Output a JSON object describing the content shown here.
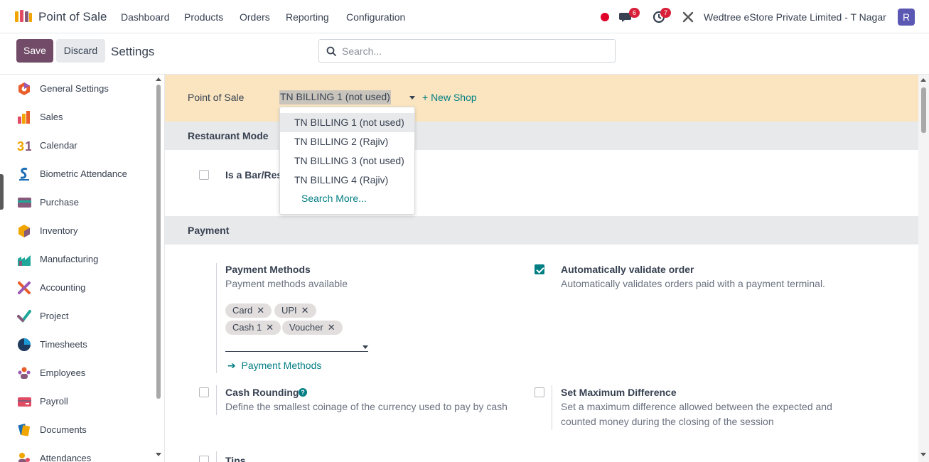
{
  "topnav": {
    "app_title": "Point of Sale",
    "menu": [
      "Dashboard",
      "Products",
      "Orders",
      "Reporting",
      "Configuration"
    ],
    "messages_badge": "6",
    "activities_badge": "7",
    "company": "Wedtree eStore Private Limited - T Nagar",
    "avatar_letter": "R"
  },
  "control": {
    "save_label": "Save",
    "discard_label": "Discard",
    "breadcrumb": "Settings",
    "search_placeholder": "Search..."
  },
  "sidebar": {
    "items": [
      {
        "label": "General Settings",
        "icon": "general-settings-icon"
      },
      {
        "label": "Sales",
        "icon": "sales-icon"
      },
      {
        "label": "Calendar",
        "icon": "calendar-icon"
      },
      {
        "label": "Biometric Attendance",
        "icon": "biometric-icon"
      },
      {
        "label": "Purchase",
        "icon": "purchase-icon"
      },
      {
        "label": "Inventory",
        "icon": "inventory-icon"
      },
      {
        "label": "Manufacturing",
        "icon": "manufacturing-icon"
      },
      {
        "label": "Accounting",
        "icon": "accounting-icon"
      },
      {
        "label": "Project",
        "icon": "project-icon"
      },
      {
        "label": "Timesheets",
        "icon": "timesheets-icon"
      },
      {
        "label": "Employees",
        "icon": "employees-icon"
      },
      {
        "label": "Payroll",
        "icon": "payroll-icon"
      },
      {
        "label": "Documents",
        "icon": "documents-icon"
      },
      {
        "label": "Attendances",
        "icon": "attendances-icon"
      }
    ]
  },
  "pos": {
    "label": "Point of Sale",
    "selected": "TN BILLING 1 (not used)",
    "new_shop": "+ New Shop",
    "dropdown": [
      "TN BILLING 1 (not used)",
      "TN BILLING 2 (Rajiv)",
      "TN BILLING 3 (not used)",
      "TN BILLING 4 (Rajiv)"
    ],
    "search_more": "Search More..."
  },
  "restaurant": {
    "heading": "Restaurant Mode",
    "bar_label": "Is a Bar/Restaurant"
  },
  "payment": {
    "heading": "Payment",
    "methods_title": "Payment Methods",
    "methods_desc": "Payment methods available",
    "tags": [
      "Card",
      "UPI",
      "Cash 1",
      "Voucher"
    ],
    "methods_link": "Payment Methods",
    "auto_title": "Automatically validate order",
    "auto_desc": "Automatically validates orders paid with a payment terminal.",
    "auto_checked": true,
    "rounding_title": "Cash Rounding",
    "rounding_desc": "Define the smallest coinage of the currency used to pay by cash",
    "maxdiff_title": "Set Maximum Difference",
    "maxdiff_desc_1": "Set a maximum difference allowed between the expected and",
    "maxdiff_desc_2": "counted money during the closing of the session",
    "tips_title": "Tips"
  },
  "colors": {
    "brand": "#714b67",
    "accent": "#017e84",
    "pos_band": "#fae5c0",
    "badge": "#d9203a"
  }
}
